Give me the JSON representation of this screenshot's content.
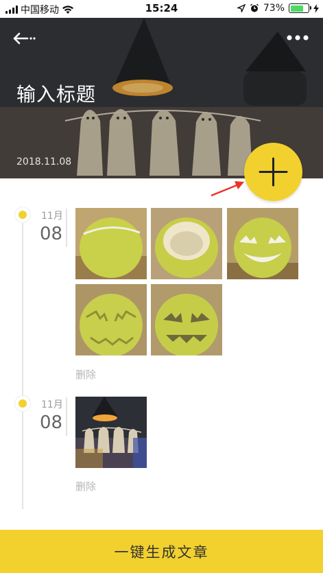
{
  "status_bar": {
    "carrier": "中国移动",
    "time": "15:24",
    "battery_percent": "73%",
    "battery_level": 0.73
  },
  "header": {
    "title": "输入标题",
    "date": "2018.11.08",
    "back_icon": "back-arrow-icon",
    "more_icon": "more-dots-icon"
  },
  "add_button": {
    "icon": "plus-icon",
    "accent": "#f2d12e"
  },
  "entries": [
    {
      "month": "11月",
      "day": "08",
      "photo_count": 5,
      "delete_label": "删除"
    },
    {
      "month": "11月",
      "day": "08",
      "photo_count": 1,
      "delete_label": "删除"
    }
  ],
  "footer": {
    "generate_label": "一键生成文章"
  },
  "colors": {
    "accent": "#f2d12e",
    "muted_text": "#b6b6b6",
    "timeline": "#e4e4e4"
  }
}
